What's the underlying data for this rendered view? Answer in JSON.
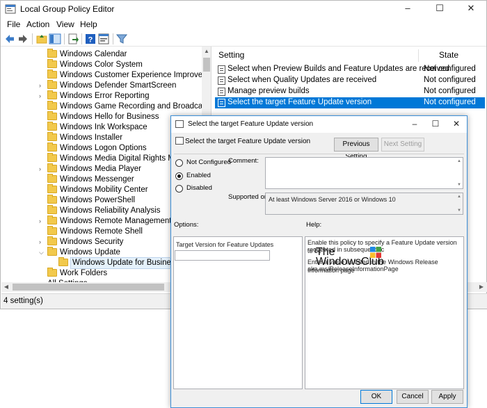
{
  "window": {
    "title": "Local Group Policy Editor",
    "minimize": "–",
    "maximize": "☐",
    "close": "✕"
  },
  "menu": [
    "File",
    "Action",
    "View",
    "Help"
  ],
  "toolbar_icons": [
    "back-arrow-icon",
    "forward-arrow-icon",
    "up-folder-icon",
    "show-hide-tree-icon",
    "export-list-icon",
    "help-icon",
    "properties-icon",
    "filter-icon"
  ],
  "tree": {
    "items": [
      {
        "label": "Windows Calendar",
        "expander": ""
      },
      {
        "label": "Windows Color System",
        "expander": ""
      },
      {
        "label": "Windows Customer Experience Improvement",
        "expander": ""
      },
      {
        "label": "Windows Defender SmartScreen",
        "expander": ">"
      },
      {
        "label": "Windows Error Reporting",
        "expander": ">"
      },
      {
        "label": "Windows Game Recording and Broadcasting",
        "expander": ""
      },
      {
        "label": "Windows Hello for Business",
        "expander": ""
      },
      {
        "label": "Windows Ink Workspace",
        "expander": ""
      },
      {
        "label": "Windows Installer",
        "expander": ""
      },
      {
        "label": "Windows Logon Options",
        "expander": ""
      },
      {
        "label": "Windows Media Digital Rights Management",
        "expander": ""
      },
      {
        "label": "Windows Media Player",
        "expander": ">"
      },
      {
        "label": "Windows Messenger",
        "expander": ""
      },
      {
        "label": "Windows Mobility Center",
        "expander": ""
      },
      {
        "label": "Windows PowerShell",
        "expander": ""
      },
      {
        "label": "Windows Reliability Analysis",
        "expander": ""
      },
      {
        "label": "Windows Remote Management (WinRM)",
        "expander": ">"
      },
      {
        "label": "Windows Remote Shell",
        "expander": ""
      },
      {
        "label": "Windows Security",
        "expander": ">"
      },
      {
        "label": "Windows Update",
        "expander": "v"
      },
      {
        "label": "Windows Update for Business",
        "expander": ""
      },
      {
        "label": "Work Folders",
        "expander": ""
      }
    ],
    "partial_last": "All Settings",
    "selected_index": 20
  },
  "list": {
    "col_setting": "Setting",
    "col_state": "State",
    "rows": [
      {
        "name": "Select when Preview Builds and Feature Updates are received",
        "state": "Not configured"
      },
      {
        "name": "Select when Quality Updates are received",
        "state": "Not configured"
      },
      {
        "name": "Manage preview builds",
        "state": "Not configured"
      },
      {
        "name": "Select the target Feature Update version",
        "state": "Not configured"
      }
    ],
    "selected_index": 3,
    "selected_color": "#0078d7"
  },
  "status": "4 setting(s)",
  "dialog": {
    "title": "Select the target Feature Update version",
    "header": "Select the target Feature Update version",
    "previous_setting": "Previous Setting",
    "next_setting": "Next Setting",
    "radio_not_configured": "Not Configured",
    "radio_enabled": "Enabled",
    "radio_disabled": "Disabled",
    "selected_radio": "Enabled",
    "comment_label": "Comment:",
    "comment_value": "",
    "supported_label": "Supported on:",
    "supported_value": "At least Windows Server 2016 or Windows 10",
    "options_label": "Options:",
    "help_label": "Help:",
    "option_field_label": "Target Version for Feature Updates",
    "option_field_value": "",
    "help_text_1": "Enable this policy to specify a Feature Update version to be",
    "help_text_2": "requested in subsequent sc",
    "help_text_3": "Enter a value as listed in the Windows Release Information page",
    "help_text_4": "aka.ms/ReleaseInformationPage",
    "ok": "OK",
    "cancel": "Cancel",
    "apply": "Apply",
    "minimize": "–",
    "maximize": "☐",
    "close": "✕"
  },
  "watermark": {
    "line1": "The",
    "line2": "WindowsClub"
  }
}
